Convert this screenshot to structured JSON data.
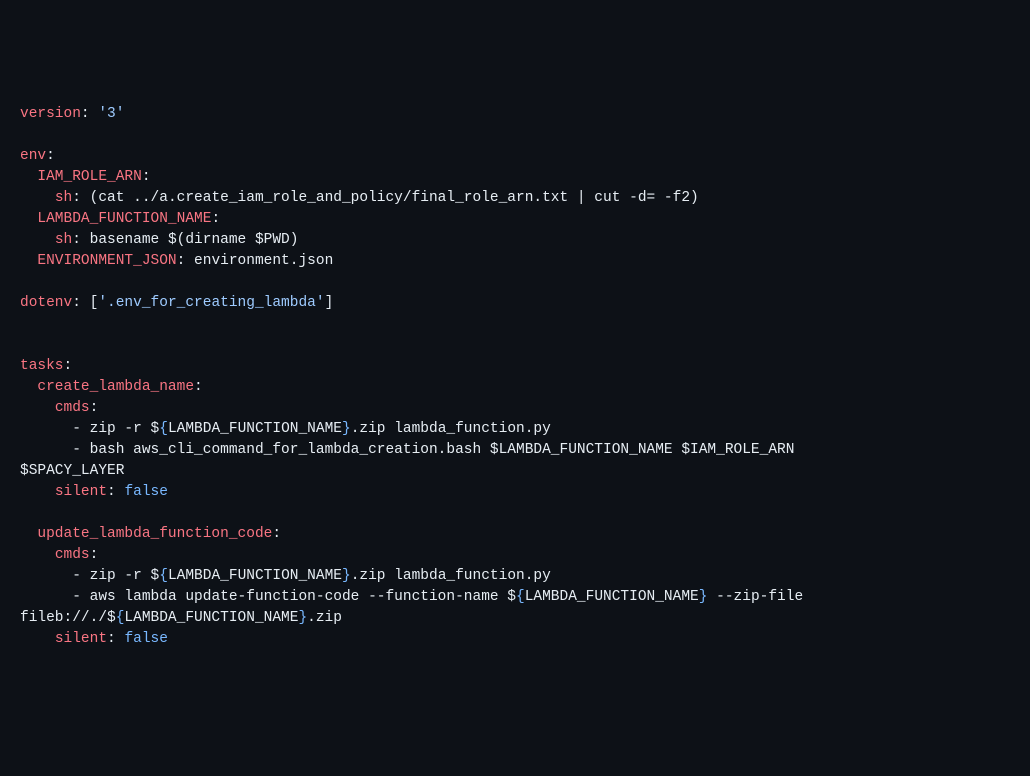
{
  "line1": {
    "version_key": "version",
    "colon": ":",
    "val": "'3'"
  },
  "line2": {
    "env_key": "env",
    "colon": ":"
  },
  "line3": {
    "k": "IAM_ROLE_ARN",
    "colon": ":"
  },
  "line4": {
    "k": "sh",
    "colon": ":",
    "v": "(cat ../a.create_iam_role_and_policy/final_role_arn.txt | cut -d= -f2)"
  },
  "line5": {
    "k": "LAMBDA_FUNCTION_NAME",
    "colon": ":"
  },
  "line6": {
    "k": "sh",
    "colon": ":",
    "v": "basename $(dirname $PWD)"
  },
  "line7": {
    "k": "ENVIRONMENT_JSON",
    "colon": ":",
    "v": "environment.json"
  },
  "line8": {
    "k": "dotenv",
    "colon": ":",
    "b1": "[",
    "q": "'.env_for_creating_lambda'",
    "b2": "]"
  },
  "line9": {
    "k": "tasks",
    "colon": ":"
  },
  "line10": {
    "k": "create_lambda_name",
    "colon": ":"
  },
  "line11": {
    "k": "cmds",
    "colon": ":"
  },
  "line12": {
    "dash": "- ",
    "p1": "zip -r $",
    "b1": "{",
    "v": "LAMBDA_FUNCTION_NAME",
    "b2": "}",
    "p2": ".zip lambda_function.py"
  },
  "line13": {
    "dash": "- ",
    "p1": "bash aws_cli_command_for_lambda_creation.bash $LAMBDA_FUNCTION_NAME $IAM_ROLE_ARN "
  },
  "line13b": {
    "p1": "$SPACY_LAYER"
  },
  "line14": {
    "k": "silent",
    "colon": ":",
    "v": "false"
  },
  "line15": {
    "k": "update_lambda_function_code",
    "colon": ":"
  },
  "line16": {
    "k": "cmds",
    "colon": ":"
  },
  "line17": {
    "dash": "- ",
    "p1": "zip -r $",
    "b1": "{",
    "v": "LAMBDA_FUNCTION_NAME",
    "b2": "}",
    "p2": ".zip lambda_function.py"
  },
  "line18": {
    "dash": "- ",
    "p1": "aws lambda update-function-code --function-name $",
    "b1": "{",
    "v": "LAMBDA_FUNCTION_NAME",
    "b2": "}",
    "p2": " --zip-file "
  },
  "line18b": {
    "p1": "fileb://./$",
    "b1": "{",
    "v": "LAMBDA_FUNCTION_NAME",
    "b2": "}",
    "p2": ".zip"
  },
  "line19": {
    "k": "silent",
    "colon": ":",
    "v": "false"
  }
}
